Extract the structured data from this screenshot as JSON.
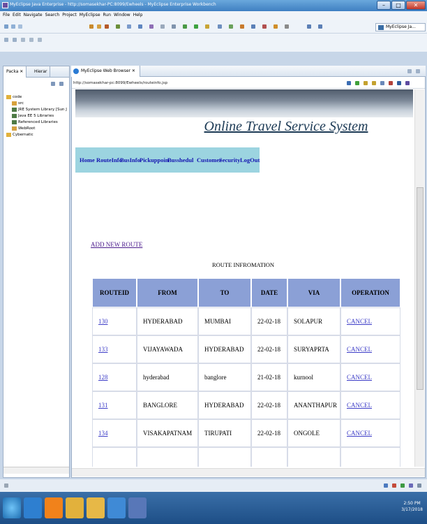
{
  "window": {
    "title": "MyEclipse Java Enterprise - http://somasekhar-PC:8099/Ewheels - MyEclipse Enterprise Workbench",
    "controls": {
      "minimize": "–",
      "maximize": "□",
      "close": "✕"
    }
  },
  "menu": [
    "File",
    "Edit",
    "Navigate",
    "Search",
    "Project",
    "MyEclipse",
    "Run",
    "Window",
    "Help"
  ],
  "perspective": {
    "label": "MyEclipse Ja..."
  },
  "left_panel": {
    "tabs": [
      "Packa ✕",
      "Hierar"
    ],
    "tree": [
      {
        "label": "code",
        "icon": "project-icon",
        "indent": 0
      },
      {
        "label": "src",
        "icon": "package-icon",
        "indent": 1
      },
      {
        "label": "JRE System Library [Sun J",
        "icon": "library-icon",
        "indent": 1
      },
      {
        "label": "Java EE 5 Libraries",
        "icon": "library-icon",
        "indent": 1
      },
      {
        "label": "Referenced Libraries",
        "icon": "library-icon",
        "indent": 1
      },
      {
        "label": "WebRoot",
        "icon": "folder-icon",
        "indent": 1
      },
      {
        "label": "Cybernatic",
        "icon": "project-icon",
        "indent": 0
      }
    ]
  },
  "editor": {
    "tab_label": "MyEclipse Web Browser ✕",
    "url": "http://somasekhar-pc:8099/Ewheels/routeinfo.jsp"
  },
  "page": {
    "site_title": "Online Travel Service System",
    "nav": [
      "Home",
      "RouteInfo",
      "BusInfo",
      "Pickuppoin",
      "Busshedul",
      "Customer",
      "Security",
      "LogOut"
    ],
    "add_link": "ADD NEW ROUTE",
    "table_caption": "ROUTE INFROMATION",
    "columns": [
      "ROUTEID",
      "FROM",
      "TO",
      "DATE",
      "VIA",
      "OPERATION"
    ],
    "rows": [
      {
        "id": "130",
        "from": "HYDERABAD",
        "to": "MUMBAI",
        "date": "22-02-18",
        "via": "SOLAPUR",
        "op": "CANCEL"
      },
      {
        "id": "133",
        "from": "VIJAYAWADA",
        "to": "HYDERABAD",
        "date": "22-02-18",
        "via": "SURYAPRTA",
        "op": "CANCEL"
      },
      {
        "id": "128",
        "from": "hyderabad",
        "to": "banglore",
        "date": "21-02-18",
        "via": "kurnool",
        "op": "CANCEL"
      },
      {
        "id": "131",
        "from": "BANGLORE",
        "to": "HYDERABAD",
        "date": "22-02-18",
        "via": "ANANTHAPUR",
        "op": "CANCEL"
      },
      {
        "id": "134",
        "from": "VISAKAPATNAM",
        "to": "TIRUPATI",
        "date": "22-02-18",
        "via": "ONGOLE",
        "op": "CANCEL"
      }
    ]
  },
  "taskbar": {
    "time": "2:50 PM",
    "date": "3/17/2018"
  }
}
